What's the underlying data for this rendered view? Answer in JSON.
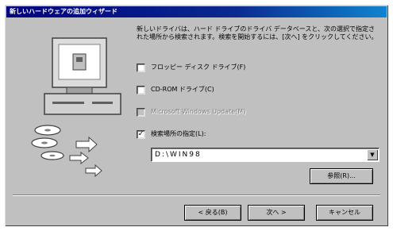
{
  "window": {
    "title": "新しいハードウェアの追加ウィザード"
  },
  "description": "新しいドライバは、ハード ドライブのドライバ データベースと、次の選択で指定された場所から検索されます。検索を開始するには、[次へ] をクリックしてください。",
  "options": {
    "floppy": {
      "label": "フロッピー ディスク ドライブ(F)",
      "checked": false
    },
    "cdrom": {
      "label": "CD-ROM ドライブ(C)",
      "checked": false
    },
    "windows_update": {
      "label": "Microsoft Windows Update(M)",
      "checked": false,
      "disabled": true
    },
    "location": {
      "label": "検索場所の指定(L):",
      "checked": true
    }
  },
  "path": {
    "value": "D:\\WIN98"
  },
  "buttons": {
    "browse": "参照(R)...",
    "back": "< 戻る(B)",
    "next": "次へ >",
    "cancel": "キャンセル"
  },
  "icons": {
    "check": "✓",
    "combo_arrow": "▼"
  }
}
